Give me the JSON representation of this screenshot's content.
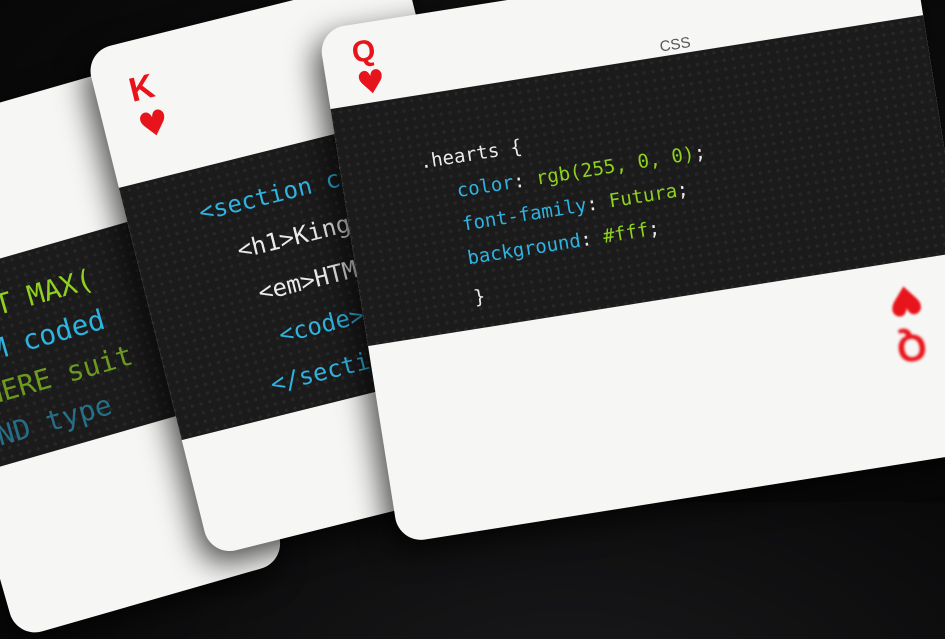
{
  "cards": {
    "sql": {
      "lines": [
        "LECT MAX(",
        "ROM coded",
        "WHERE suit",
        "AND type"
      ]
    },
    "king": {
      "rank": "K",
      "suit_icon": "heart-icon",
      "lines": [
        "<section cl",
        "<h1>King",
        "<em>HTML",
        "<code> ",
        "</section"
      ]
    },
    "queen": {
      "rank": "Q",
      "suit_icon": "heart-icon",
      "label": "CSS",
      "code": {
        "selector": ".hearts",
        "open_brace": "{",
        "close_brace": "}",
        "declarations": [
          {
            "property": "color",
            "value": "rgb(255, 0, 0)"
          },
          {
            "property": "font-family",
            "value": "Futura"
          },
          {
            "property": "background",
            "value": "#fff"
          }
        ]
      },
      "bottom_rank": "Q"
    }
  },
  "colors": {
    "suit_red": "#e8141b",
    "band_black": "#1b1b1b",
    "card_white": "#f6f6f4",
    "code_cyan": "#2fb3e0",
    "code_green": "#8fd11f"
  }
}
